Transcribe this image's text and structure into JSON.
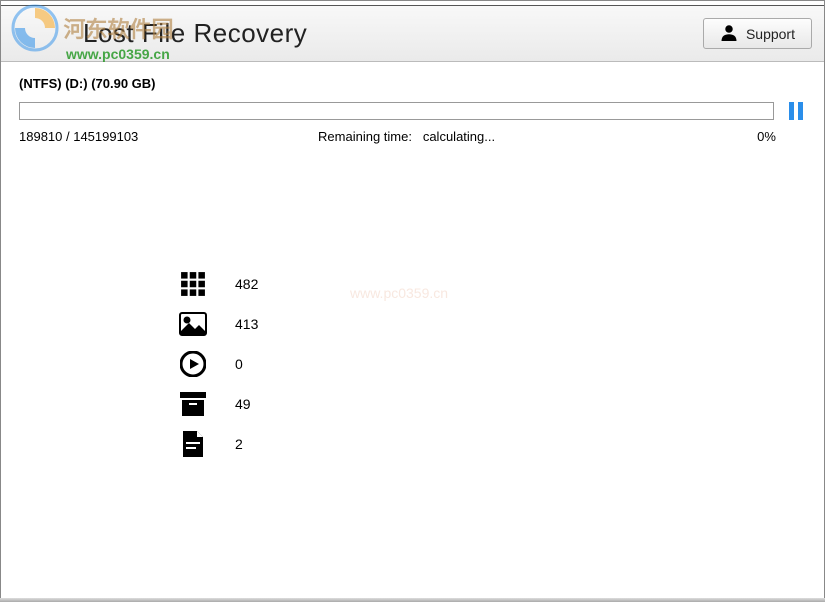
{
  "watermark": {
    "text": "河东软件园",
    "url": "www.pc0359.cn"
  },
  "header": {
    "title": "Lost File Recovery",
    "support_label": "Support"
  },
  "scan": {
    "drive_label": "(NTFS) (D:) (70.90 GB)",
    "count_status": "189810 / 145199103",
    "remaining_label": "Remaining time:",
    "remaining_value": "calculating...",
    "percent": "0%",
    "progress_percent": 0
  },
  "categories": {
    "all": "482",
    "images": "413",
    "video": "0",
    "archive": "49",
    "document": "2"
  }
}
